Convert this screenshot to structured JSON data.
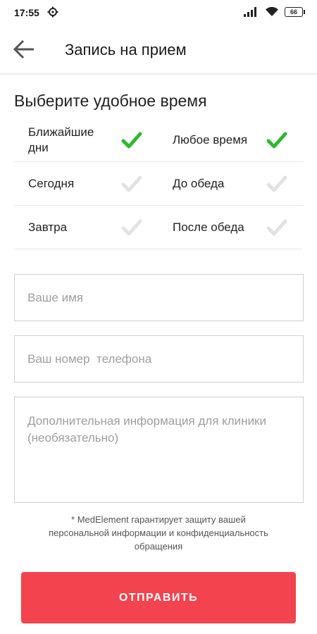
{
  "status_bar": {
    "time": "17:55",
    "icons": [
      "settings-gear-icon",
      "signal-icon",
      "wifi-icon",
      "battery-icon"
    ],
    "battery": "66"
  },
  "app_bar": {
    "back_icon": "arrow-left-icon",
    "title": "Запись на прием"
  },
  "time_section": {
    "title": "Выберите удобное время",
    "options": [
      {
        "label": "Ближайшие дни",
        "checked": true
      },
      {
        "label": "Любое время",
        "checked": true
      },
      {
        "label": "Сегодня",
        "checked": false
      },
      {
        "label": "До обеда",
        "checked": false
      },
      {
        "label": "Завтра",
        "checked": false
      },
      {
        "label": "После обеда",
        "checked": false
      }
    ]
  },
  "form": {
    "name_placeholder": "Ваше имя",
    "name_value": "",
    "phone_placeholder": "Ваш номер  телефона",
    "phone_value": "",
    "info_placeholder": "Дополнительная информация для клиники (необязательно)",
    "info_value": ""
  },
  "privacy_note": "* MedElement гарантирует защиту вашей персональной информации и конфиденциальность обращения",
  "submit_label": "ОТПРАВИТЬ",
  "colors": {
    "accent": "#f2434e",
    "check_active": "#2eb82e",
    "check_inactive": "#e2e2e2"
  }
}
